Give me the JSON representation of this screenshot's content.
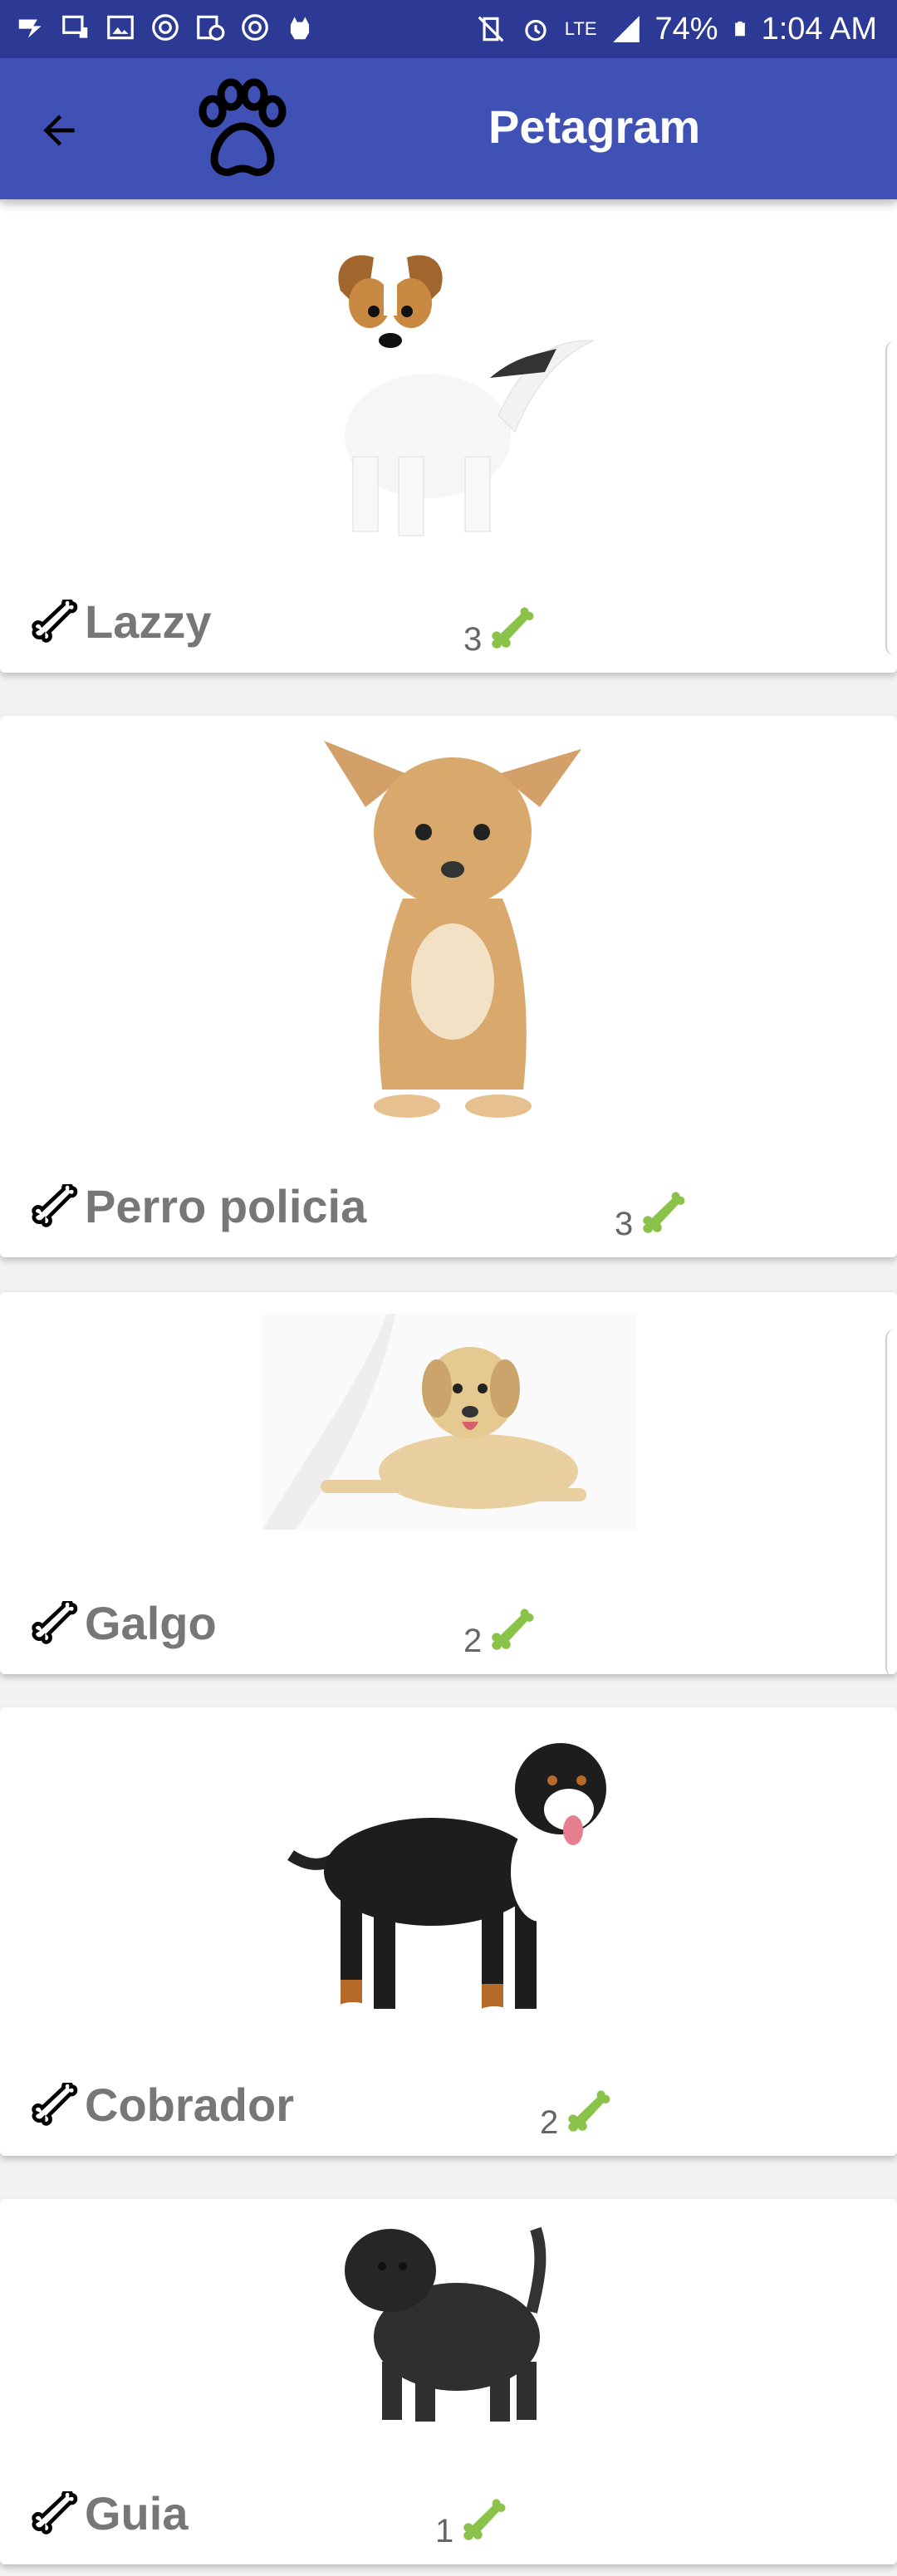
{
  "status_bar": {
    "left_icons": [
      "notification-icon",
      "cast-icon",
      "image-icon",
      "sync-icon",
      "schedule-icon",
      "sync-icon",
      "android-icon"
    ],
    "right_icons": [
      "vibrate-mute-icon",
      "alarm-icon",
      "lte-icon",
      "signal-icon",
      "battery-icon"
    ],
    "battery": "74%",
    "time": "1:04 AM",
    "network": "LTE"
  },
  "app_bar": {
    "title": "Petagram",
    "back_icon": "arrow-back-icon",
    "logo_icon": "paw-icon",
    "background": "#3f51b5",
    "status_background": "#2c3a96"
  },
  "pets": [
    {
      "name": "Lazzy",
      "likes": "3",
      "image": "jack-russell-puppy"
    },
    {
      "name": "Perro policia",
      "likes": "3",
      "image": "chihuahua"
    },
    {
      "name": "Galgo",
      "likes": "2",
      "image": "labrador-lying"
    },
    {
      "name": "Cobrador",
      "likes": "2",
      "image": "swiss-mountain-dog"
    },
    {
      "name": "Guia",
      "likes": "1",
      "image": "affenpinscher"
    }
  ],
  "colors": {
    "accent_green": "#8bc34a",
    "name_gray": "#777777"
  }
}
